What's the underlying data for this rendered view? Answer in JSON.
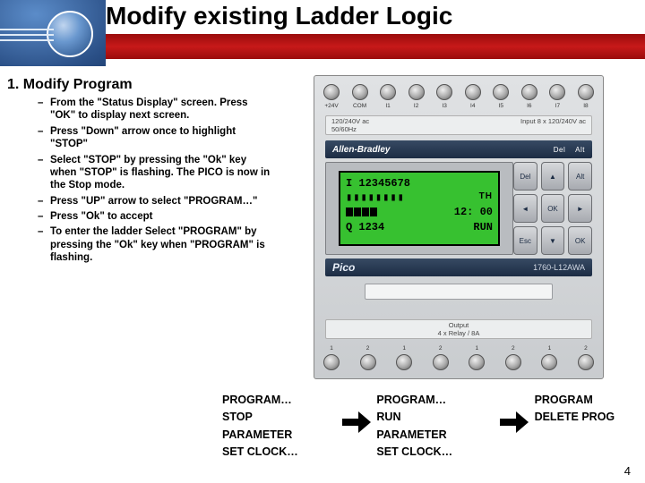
{
  "title": "Modify existing Ladder Logic",
  "section_heading": "1. Modify Program",
  "bullets": [
    "From the \"Status Display\" screen. Press \"OK\" to display next screen.",
    "Press \"Down\" arrow once to highlight \"STOP\"",
    "Select \"STOP\" by pressing the \"Ok\" key when \"STOP\" is flashing. The PICO is now in the Stop mode.",
    "Press \"UP\" arrow to select \"PROGRAM…\"",
    "Press \"Ok\" to accept",
    "To enter the ladder Select \"PROGRAM\" by pressing the \"Ok\" key when \"PROGRAM\" is flashing."
  ],
  "device": {
    "top_labels": [
      "+24V",
      "COM",
      "I1",
      "I2",
      "I3",
      "I4",
      "I5",
      "I6",
      "I7",
      "I8"
    ],
    "bottom_labels": [
      "1",
      "2",
      "1",
      "2",
      "1",
      "2",
      "1",
      "2"
    ],
    "spec_left_top": "120/240V ac",
    "spec_left_bot": "50/60Hz",
    "spec_right": "Input 8 x 120/240V ac",
    "brand": "Allen-Bradley",
    "brand_right_1": "Del",
    "brand_right_2": "Alt",
    "buttons": [
      "Del",
      "▲",
      "Alt",
      "◄",
      "OK",
      "►",
      "Esc",
      "▼",
      "OK"
    ],
    "model_left": "Pico",
    "model_right": "1760-L12AWA",
    "output_spec_l1": "Output",
    "output_spec_l2": "4 x Relay / 8A"
  },
  "lcd": {
    "line1": "I 12345678",
    "line2_blocks": "▮▮▮▮▮▮▮▮",
    "line2_th": "TH",
    "line3_blocks": 4,
    "line3_time": "12: 00",
    "line4_left": "Q 1234",
    "line4_right": "RUN"
  },
  "menus": {
    "col1": [
      "PROGRAM…",
      "STOP",
      "PARAMETER",
      "SET CLOCK…"
    ],
    "col2": [
      "PROGRAM…",
      "RUN",
      "PARAMETER",
      "SET CLOCK…"
    ],
    "col3": [
      "PROGRAM",
      "DELETE PROG"
    ]
  },
  "page_number": "4"
}
